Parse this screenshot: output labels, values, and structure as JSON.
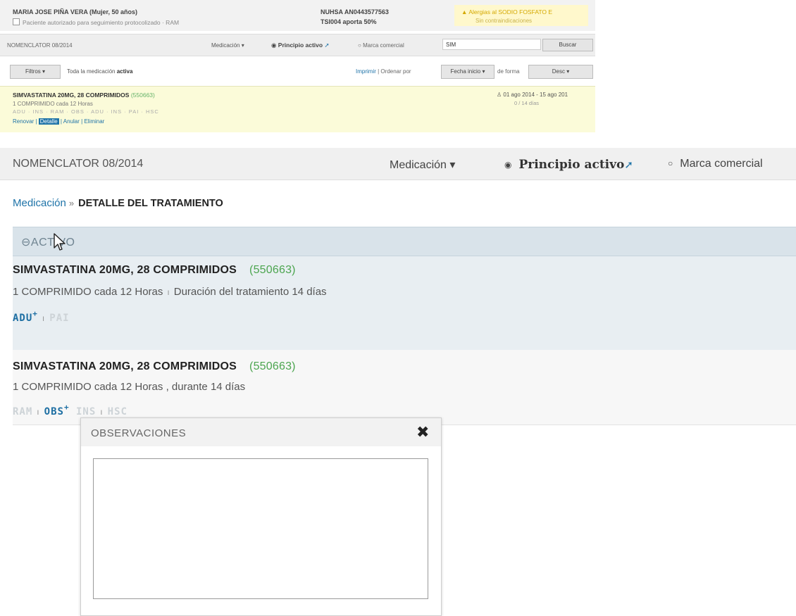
{
  "thumbnail": {
    "patient": "MARIA JOSE PIÑA VERA (Mujer, 50 años)",
    "authorized_label": "Paciente autorizado para seguimiento protocolizado · RAM",
    "nuhsa": "NUHSA AN0443577563",
    "tsi": "TSI004 aporta 50%",
    "alert": "Alergias al SODIO FOSFATO E",
    "no_contra": "Sin contraindicaciones",
    "nomenclator": "NOMENCLATOR 08/2014",
    "medicacion": "Medicación ▾",
    "principio_activo": "Principio activo",
    "marca_comercial": "Marca comercial",
    "search_value": "SIM",
    "buscar": "Buscar",
    "filtros": "Filtros ▾",
    "toda_prefix": "Toda la medicación",
    "toda_bold": "activa",
    "imprimir": "Imprimir",
    "ordenar": "| Ordenar por",
    "fecha_inicio": "Fecha inicio ▾",
    "de_forma": "de forma",
    "desc": "Desc ▾",
    "drug": "SIMVASTATINA 20MG, 28 COMPRIMIDOS",
    "drug_code": "(550663)",
    "dose": "1 COMPRIMIDO cada 12 Horas",
    "tags": "ADU · INS · RAM · OBS · ADU · INS · PAI · HSC",
    "action_renovar": "Renovar",
    "action_detalle": "Detalle",
    "action_anular": "Anular",
    "action_eliminar": "Eliminar",
    "date_range": "01 ago 2014 - 15 ago 201",
    "days": "0 / 14 días"
  },
  "nav": {
    "nomenclator": "NOMENCLATOR 08/2014",
    "medicacion": "Medicación ▾",
    "principio_activo": "Principio activo",
    "marca_comercial": "Marca comercial"
  },
  "breadcrumb": {
    "link": "Medicación",
    "sep": "»",
    "current": "DETALLE DEL TRATAMIENTO"
  },
  "section": {
    "label": "ACTIVO",
    "toggle_icon": "minus-circle-icon"
  },
  "treatment1": {
    "title": "SIMVASTATINA 20MG, 28 COMPRIMIDOS",
    "code": "(550663)",
    "dose": "1 COMPRIMIDO cada 12 Horas",
    "duration": "Duración del tratamiento 14 días",
    "tag_adu": "ADU",
    "tag_pai": "PAI",
    "plus": "+"
  },
  "treatment2": {
    "title": "SIMVASTATINA 20MG, 28 COMPRIMIDOS",
    "code": "(550663)",
    "dose": "1 COMPRIMIDO cada 12 Horas , durante 14 días",
    "tag_ram": "RAM",
    "tag_obs": "OBS",
    "tag_ins": "INS",
    "tag_hsc": "HSC",
    "plus": "+"
  },
  "popup": {
    "title": "OBSERVACIONES",
    "close_icon": "close-icon",
    "textarea_value": ""
  },
  "colors": {
    "link": "#1e73a8",
    "code_green": "#4ca54f",
    "section_bg": "#e8eef2"
  }
}
